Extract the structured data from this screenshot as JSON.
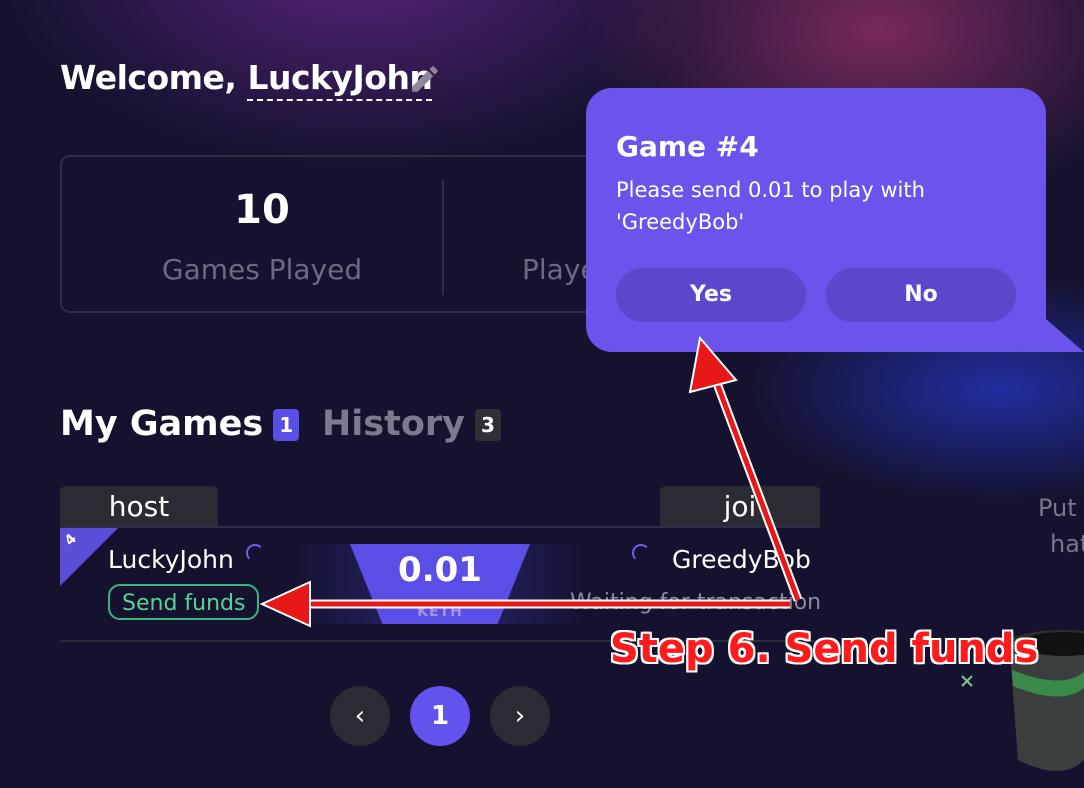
{
  "welcome": {
    "prefix": "Welcome,",
    "username": "LuckyJohn"
  },
  "stats": {
    "games_played_value": "10",
    "games_played_label": "Games Played",
    "second_label_partial": "Playe"
  },
  "tabs": [
    {
      "label": "My Games",
      "count": "1"
    },
    {
      "label": "History",
      "count": "3"
    }
  ],
  "table": {
    "columns": {
      "host": "host",
      "join": "joi"
    },
    "row": {
      "game_number": "4",
      "host_name": "LuckyJohn",
      "host_action": "Send funds",
      "bet_value": "0.01",
      "bet_unit": "KETH",
      "join_name": "GreedyBob",
      "join_status": "Waiting for transaction"
    }
  },
  "side": {
    "line1": "Put",
    "line2": "hat"
  },
  "pagination": {
    "prev": "‹",
    "current": "1",
    "next": "›"
  },
  "modal": {
    "title": "Game #4",
    "message": "Please send 0.01 to play with 'GreedyBob'",
    "yes_label": "Yes",
    "no_label": "No"
  },
  "annotation": {
    "text": "Step 6. Send funds",
    "color": "#ff1b1b"
  },
  "colors": {
    "accent": "#6b54ec",
    "success": "#39b383",
    "background": "#14122e"
  }
}
